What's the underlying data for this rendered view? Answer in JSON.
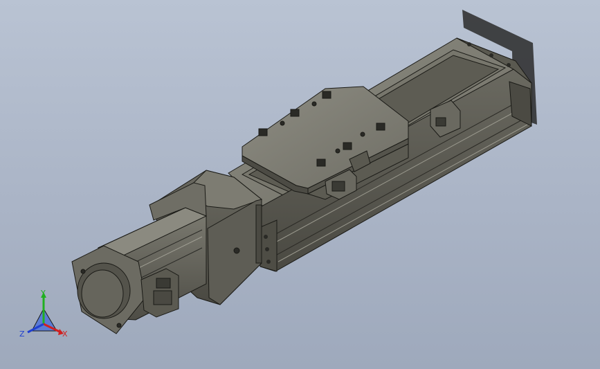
{
  "viewport": {
    "background_top": "#b9c3d3",
    "background_bottom": "#9ea9bc"
  },
  "model": {
    "description_color_body": "#5f5e55",
    "description_color_highlight": "#8a897e",
    "description_color_edge": "#1a1a16"
  },
  "triad": {
    "x_label": "X",
    "y_label": "Y",
    "z_label": "Z",
    "x_color": "#d02020",
    "y_color": "#20b020",
    "z_color": "#2040d0"
  }
}
